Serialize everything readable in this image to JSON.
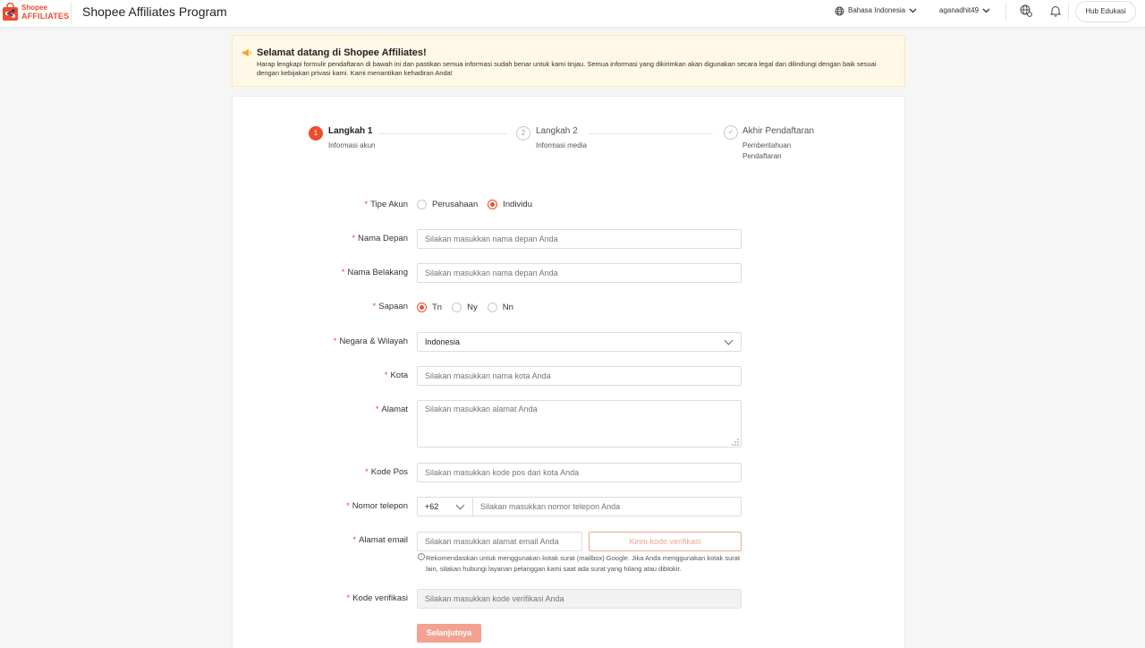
{
  "topbar": {
    "logo_top": "Shopee",
    "logo_bottom": "AFFILIATES",
    "app_title": "Shopee Affiliates Program",
    "language": "Bahasa Indonesia",
    "username": "aganadhit49",
    "hub_button": "Hub Edukasi"
  },
  "notice": {
    "title": "Selamat datang di Shopee Affiliates!",
    "body": "Harap lengkapi formulir pendaftaran di bawah ini dan pastikan semua informasi sudah benar untuk kami tinjau. Semua informasi yang dikirimkan akan digunakan secara legal dan dilindungi dengan baik sesuai dengan kebijakan privasi kami. Kami menantikan kehadiran Anda!"
  },
  "steps": [
    {
      "number": "1",
      "title": "Langkah 1",
      "subtitle": "Informasi akun"
    },
    {
      "number": "2",
      "title": "Langkah 2",
      "subtitle": "Informasi media"
    },
    {
      "number": "✓",
      "title": "Akhir Pendaftaran",
      "subtitle_line1": "Pemberitahuan",
      "subtitle_line2": "Pendaftaran"
    }
  ],
  "form": {
    "required_mark": "*",
    "account_type": {
      "label": "Tipe Akun",
      "options": [
        "Perusahaan",
        "Individu"
      ],
      "selected": "Individu"
    },
    "first_name": {
      "label": "Nama Depan",
      "placeholder": "Silakan masukkan nama depan Anda"
    },
    "last_name": {
      "label": "Nama Belakang",
      "placeholder": "Silakan masukkan nama depan Anda"
    },
    "salutation": {
      "label": "Sapaan",
      "options": [
        "Tn",
        "Ny",
        "Nn"
      ],
      "selected": "Tn"
    },
    "country": {
      "label": "Negara & Wilayah",
      "value": "Indonesia"
    },
    "city": {
      "label": "Kota",
      "placeholder": "Silakan masukkan nama kota Anda"
    },
    "address": {
      "label": "Alamat",
      "placeholder": "Silakan masukkan alamat Anda"
    },
    "postal_code": {
      "label": "Kode Pos",
      "placeholder": "Silakan masukkan kode pos dari kota Anda"
    },
    "phone": {
      "label": "Nomor telepon",
      "prefix": "+62",
      "placeholder": "Silakan masukkan nomor telepon Anda"
    },
    "email": {
      "label": "Alamat email",
      "placeholder": "Silakan masukkan alamat email Anda",
      "send_button": "Kirim kode verifikasi",
      "hint": "Rekomendasikan untuk menggunakan kotak surat (mailbox) Google. Jika Anda menggunakan kotak surat lain, silakan hubungi layanan pelanggan kami saat ada surat yang hilang atau diblokir."
    },
    "verification_code": {
      "label": "Kode verifikasi",
      "placeholder": "Silakan masukkan kode verifikasi Anda"
    },
    "next_button": "Selanjutnya"
  },
  "colors": {
    "brand": "#ee4d2d",
    "notice_bg": "#fff8e6",
    "button_disabled": "#f3a291"
  }
}
